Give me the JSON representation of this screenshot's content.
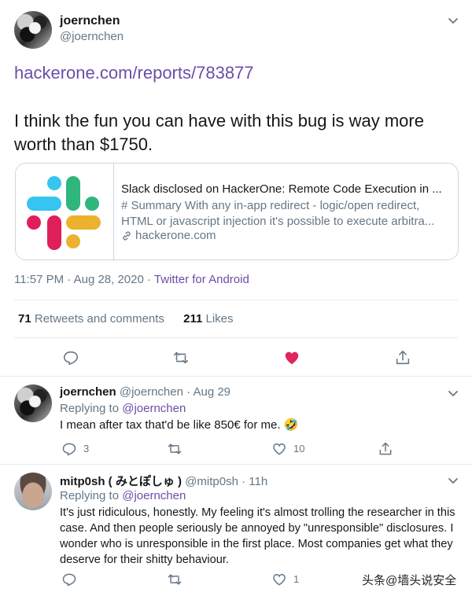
{
  "main_tweet": {
    "display_name": "joernchen",
    "handle": "@joernchen",
    "link_text": "hackerone.com/reports/783877",
    "body": "I think the fun you can have with this bug is way more worth than $1750.",
    "card": {
      "title": "Slack disclosed on HackerOne: Remote Code Execution in ...",
      "description": "# Summary With any in-app redirect - logic/open redirect, HTML or javascript injection it's possible to execute arbitra...",
      "domain": "hackerone.com",
      "logo_colors": [
        "#36c5f0",
        "#2eb67d",
        "#ecb22e",
        "#e01e5a"
      ]
    },
    "timestamp": "11:57 PM · Aug 28, 2020 · ",
    "source": "Twitter for Android",
    "retweets_count": "71",
    "retweets_label": " Retweets and comments",
    "likes_count": "211",
    "likes_label": " Likes",
    "liked_color": "#e0245e"
  },
  "replies": [
    {
      "display_name": "joernchen",
      "meta": " @joernchen · Aug 29",
      "replying_prefix": "Replying to ",
      "replying_to": "@joernchen",
      "text": "I mean after tax that'd be like 850€ for me. 🤣",
      "reply_count": "3",
      "retweet_count": "",
      "like_count": "10"
    },
    {
      "display_name": "mitp0sh ( みとぽしゅ )",
      "meta": " @mitp0sh · 11h",
      "replying_prefix": "Replying to ",
      "replying_to": "@joernchen",
      "text": "It's just ridiculous, honestly. My feeling it's almost trolling the researcher in this case. And then people seriously be annoyed by \"unresponsible\" disclosures. I wonder who is unresponsible in the first place. Most companies get what they deserve for their shitty behaviour.",
      "reply_count": "",
      "retweet_count": "",
      "like_count": "1"
    }
  ],
  "watermark": "头条@墙头说安全"
}
